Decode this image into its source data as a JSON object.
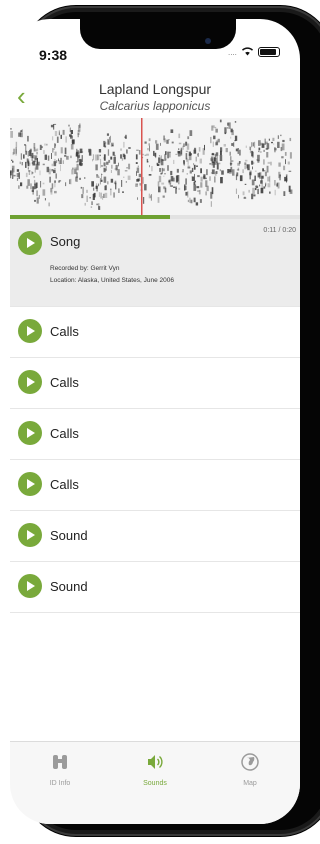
{
  "status": {
    "time": "9:38",
    "signal": "....",
    "wifi": "wifi"
  },
  "nav": {
    "back": "‹",
    "title": "Lapland Longspur",
    "subtitle": "Calcarius lapponicus"
  },
  "player": {
    "time": "0:11 / 0:20",
    "progress": 0.55
  },
  "recordings": [
    {
      "label": "Song",
      "recorded_by": "Recorded by: Gerrit Vyn",
      "location": "Location: Alaska, United States, June 2006"
    },
    {
      "label": "Calls"
    },
    {
      "label": "Calls"
    },
    {
      "label": "Calls"
    },
    {
      "label": "Calls"
    },
    {
      "label": "Sound"
    },
    {
      "label": "Sound"
    }
  ],
  "tabs": [
    {
      "label": "ID Info",
      "icon": "binoculars-icon"
    },
    {
      "label": "Sounds",
      "icon": "speaker-icon"
    },
    {
      "label": "Map",
      "icon": "globe-icon"
    }
  ],
  "colors": {
    "accent": "#79a93b",
    "progress": "#6ea132",
    "active_row": "#ececec"
  }
}
